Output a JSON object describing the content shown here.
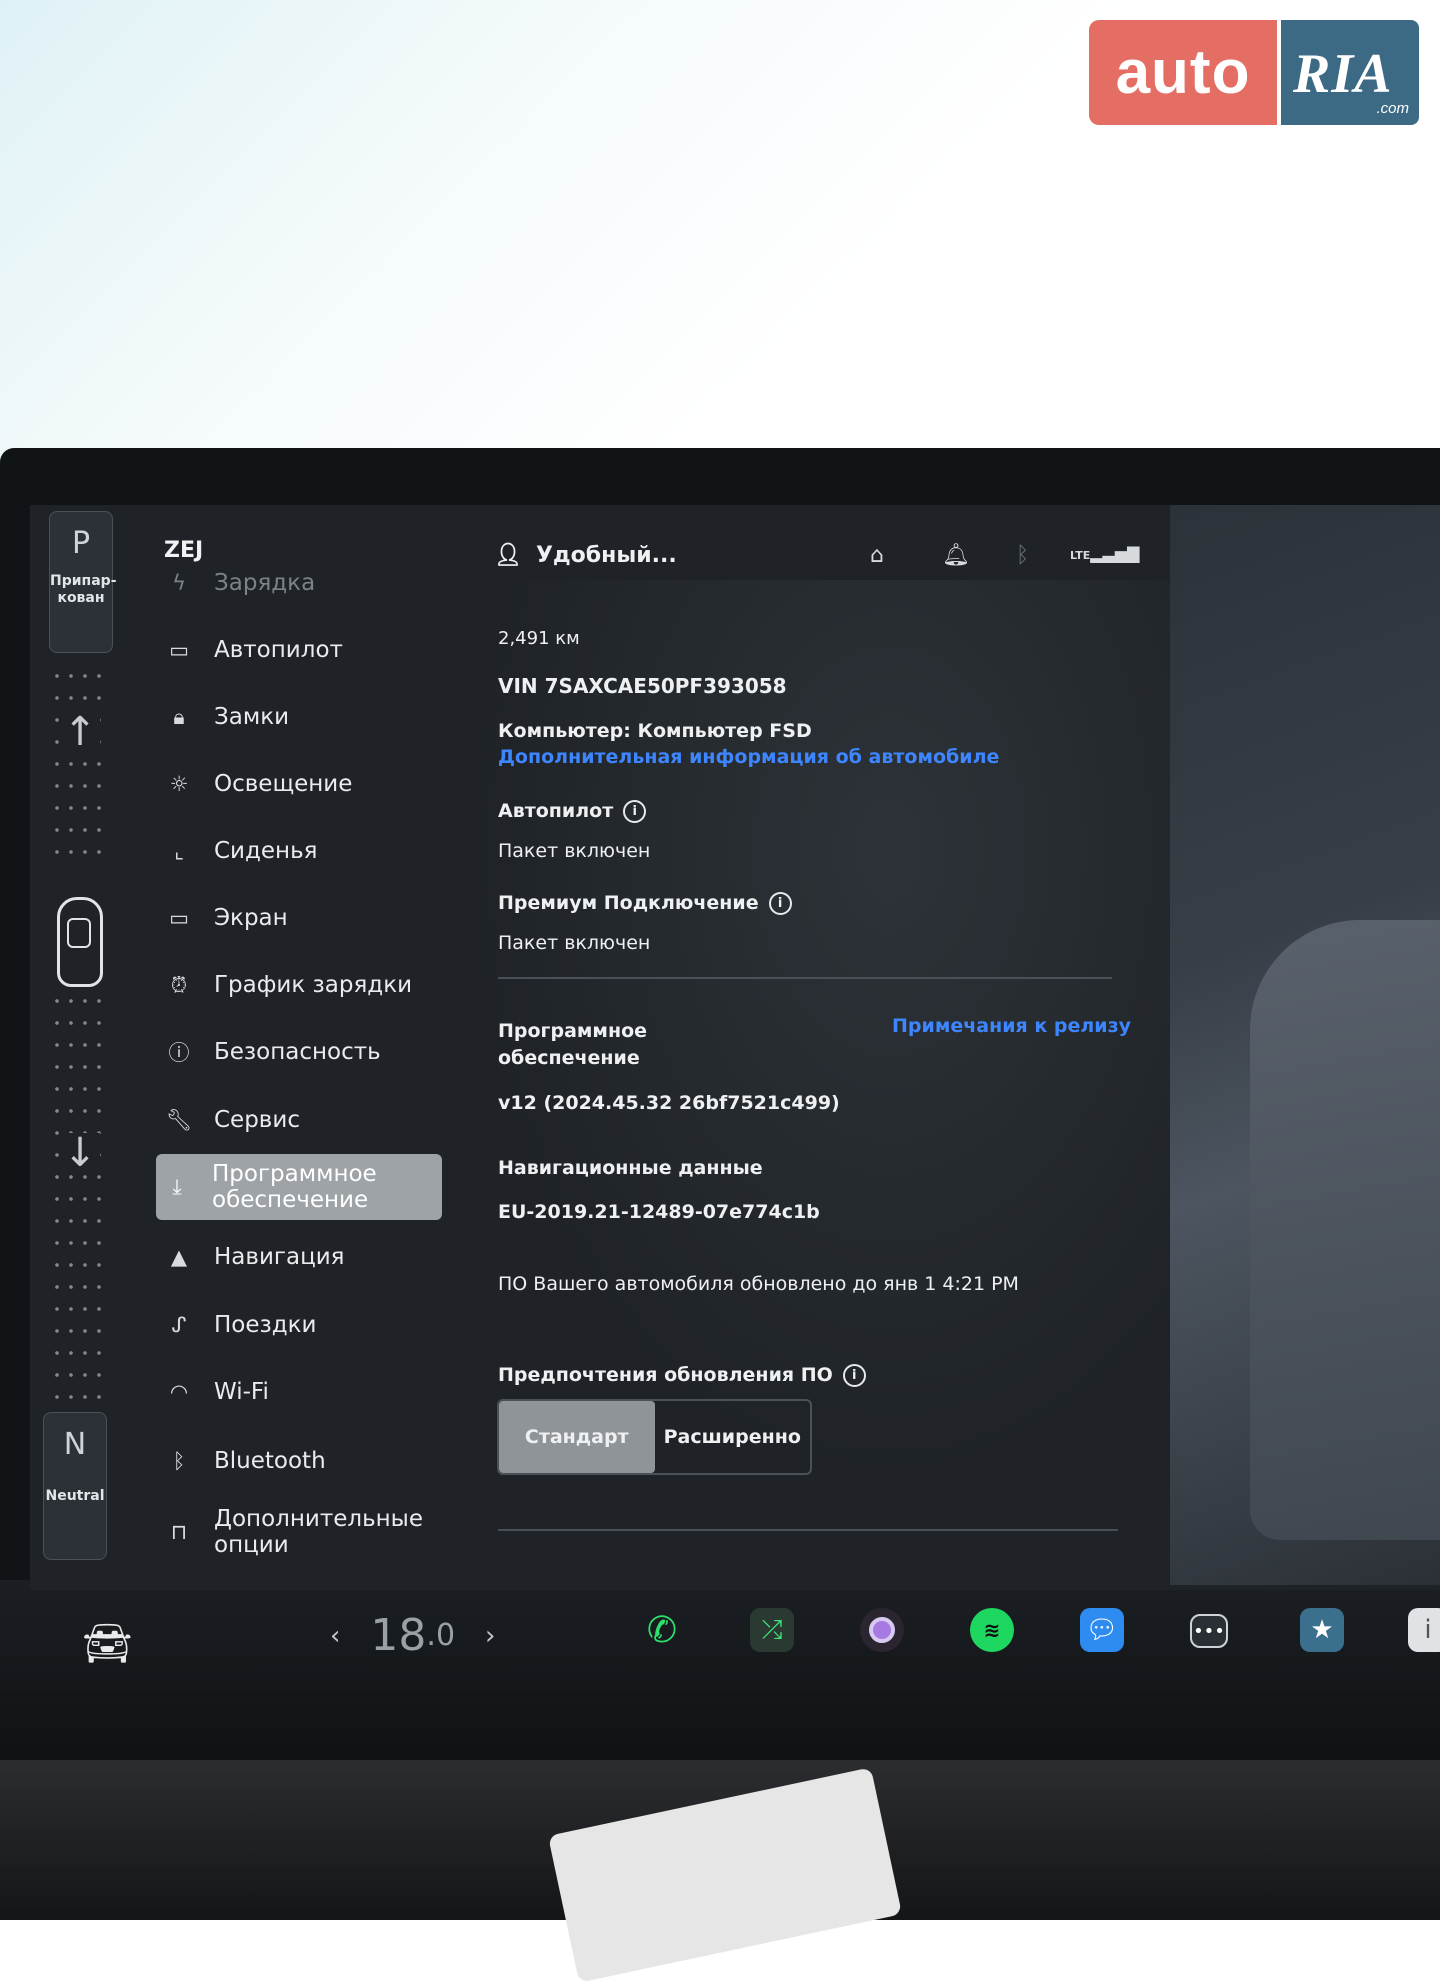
{
  "logo": {
    "brand": "auto",
    "brand2": "RIA",
    "domain": ".com"
  },
  "gear": {
    "park_letter": "P",
    "park_label": "Припар-\nкован",
    "neutral_letter": "N",
    "neutral_label": "Neutral"
  },
  "sidebar": {
    "vehicle_name": "ZEJ",
    "items": [
      {
        "label": "Зарядка",
        "icon": "bolt-icon"
      },
      {
        "label": "Автопилот",
        "icon": "steering-wheel-icon"
      },
      {
        "label": "Замки",
        "icon": "lock-icon"
      },
      {
        "label": "Освещение",
        "icon": "sun-icon"
      },
      {
        "label": "Сиденья",
        "icon": "seat-icon"
      },
      {
        "label": "Экран",
        "icon": "display-icon"
      },
      {
        "label": "График зарядки",
        "icon": "alarm-clock-icon"
      },
      {
        "label": "Безопасность",
        "icon": "alert-circle-icon"
      },
      {
        "label": "Сервис",
        "icon": "wrench-icon"
      },
      {
        "label": "Программное обеспечение",
        "icon": "download-icon"
      },
      {
        "label": "Навигация",
        "icon": "navigation-arrow-icon"
      },
      {
        "label": "Поездки",
        "icon": "trips-icon"
      },
      {
        "label": "Wi-Fi",
        "icon": "wifi-icon"
      },
      {
        "label": "Bluetooth",
        "icon": "bluetooth-icon"
      },
      {
        "label": "Дополнительные опции",
        "icon": "shopping-bag-icon"
      }
    ]
  },
  "status_bar": {
    "profile_name": "Удобный...",
    "lte_label": "LTE"
  },
  "software": {
    "odometer": "2,491 км",
    "vin": "VIN 7SAXCAE50PF393058",
    "computer": "Компьютер: Компьютер FSD",
    "more_info_link": "Дополнительная информация об автомобиле",
    "autopilot_title": "Автопилот",
    "autopilot_value": "Пакет включен",
    "premium_title": "Премиум Подключение",
    "premium_value": "Пакет включен",
    "software_title": "Программное\nобеспечение",
    "release_notes_link": "Примечания к релизу",
    "version": "v12 (2024.45.32 26bf7521c499)",
    "nav_data_title": "Навигационные данные",
    "nav_data_value": "EU-2019.21-12489-07e774c1b",
    "updated_text": "ПО Вашего автомобиля обновлено до янв 1 4:21 PM",
    "update_pref_title": "Предпочтения обновления ПО",
    "update_options": [
      "Стандарт",
      "Расширенно"
    ],
    "update_selected": "Стандарт"
  },
  "dock": {
    "temp_left": "‹",
    "temp_value": "18",
    "temp_decimal": ".0",
    "temp_right": "›",
    "apps": [
      "phone-icon",
      "shuffle-icon",
      "camera-icon",
      "spotify-icon",
      "messages-icon",
      "more-icon",
      "photos-icon"
    ]
  }
}
